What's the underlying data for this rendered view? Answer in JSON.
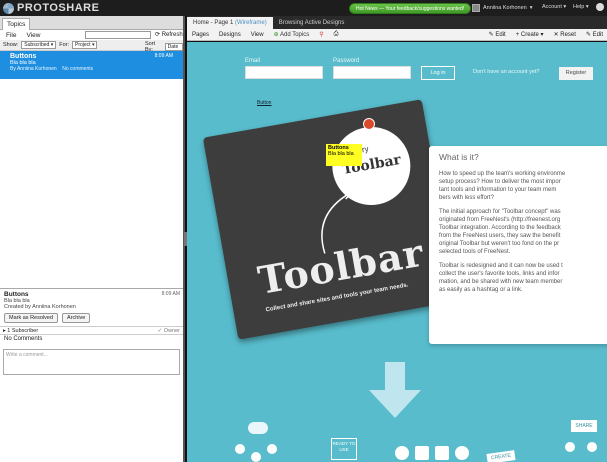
{
  "app": {
    "logo": "PROTOSHARE",
    "new_button": "Hot News — Your feedback/suggestions wanted!",
    "user": "Anniina Korhonen",
    "account": "Account",
    "help": "Help"
  },
  "left": {
    "tab": "Topics",
    "menu": [
      "File",
      "View"
    ],
    "refresh": "Refresh",
    "filter": {
      "show_label": "Show:",
      "show_value": "Subscribed",
      "for_label": "For:",
      "for_value": "Project",
      "sort_label": "Sort By:",
      "sort_value": "Date"
    },
    "topic": {
      "title": "Buttons",
      "snippet": "Bla bla bla",
      "time": "8:09 AM",
      "author": "By Anniina Korhonen",
      "comments": "No comments"
    },
    "detail": {
      "title": "Buttons",
      "time": "8:09 AM",
      "body": "Bla bla bla",
      "created": "Created by Anniina Korhonen",
      "mark": "Mark as Resolved",
      "archive": "Archive"
    },
    "subscribers": "1 Subscriber",
    "follow": "Owner",
    "no_comments": "No Comments",
    "comment_placeholder": "Write a comment..."
  },
  "right": {
    "tabs": [
      {
        "label": "Home - Page 1",
        "suffix": "(Wireframe)"
      },
      {
        "label": "Browsing Active Designs"
      }
    ],
    "toolbar": [
      "Pages",
      "Designs",
      "View"
    ],
    "add_topics": "Add Topics",
    "toolbar_right": [
      "Edit",
      "Create",
      "Reset",
      "Edit"
    ],
    "canvas": {
      "email": "Email",
      "password": "Password",
      "login": "Log in",
      "no_account": "Don't have an account yet?",
      "register": "Register",
      "button_link": "Button",
      "card": {
        "try": "Try",
        "toolbar_small": "Toolbar",
        "toolbar_big": "Toolbar",
        "tagline": "Collect and share sites and tools your team needs."
      },
      "note": {
        "title": "Buttons",
        "body": "Bla bla bla"
      },
      "info": {
        "heading": "What is it?",
        "p1": [
          "How to speed up the team's working environme",
          "setup process? How to deliver the most impor",
          "tant tools and information to your team mem",
          "bers with less effort?"
        ],
        "p2": [
          "The initial approach for \"Toolbar concept\" was",
          "originated from FreeNest's (http://freenest.org",
          "Toolbar integration. According to the feedback",
          "from the FreeNest users, they saw the benefit",
          "original Toolbar but weren't too fond on the pr",
          "selected tools of FreeNest."
        ],
        "p3": [
          "Toolbar is redesigned and it can now be used t",
          "collect the user's favorite tools, links and infor",
          "mation, and be shared with new team member",
          "as easily as a hashtag or a link."
        ]
      },
      "ready": "READY TO USE",
      "create": "CREATE",
      "share": "SHARE"
    }
  }
}
